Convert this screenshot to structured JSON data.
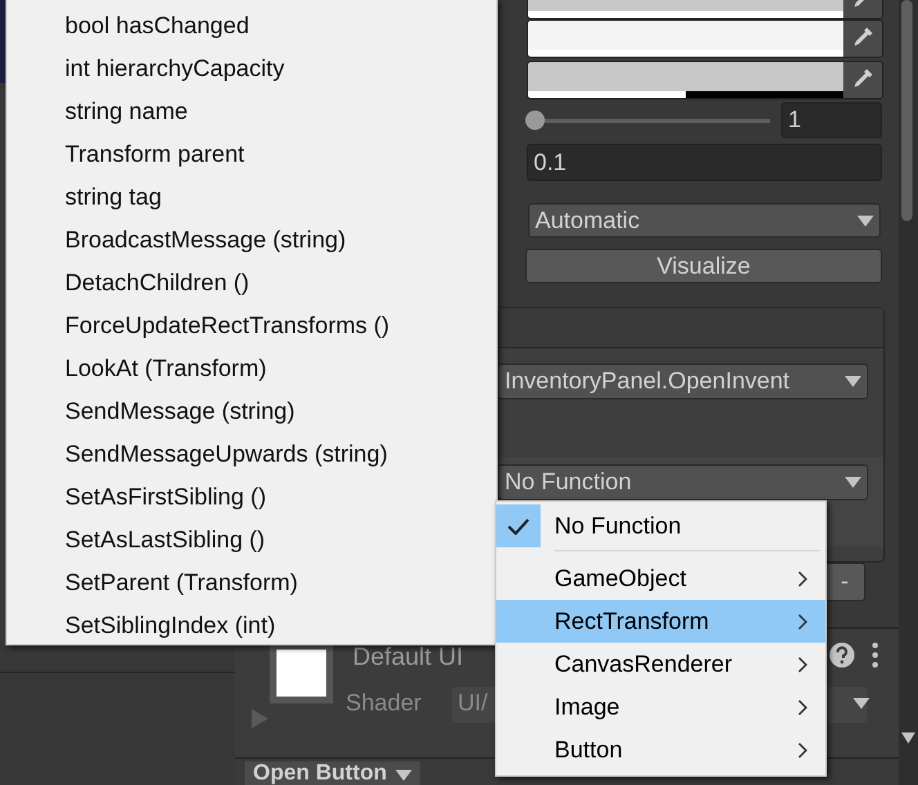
{
  "inspector": {
    "color_fields": [
      {
        "color": "#c8c8c8",
        "level": 1
      },
      {
        "color": "#f4f4f4",
        "level": 1
      },
      {
        "color": "#c8c8c8",
        "level": 0.5
      }
    ],
    "slider": {
      "level": 0,
      "value": "1"
    },
    "number_field": {
      "value": "0.1"
    },
    "mode_dropdown": {
      "value": "Automatic"
    },
    "visualize_button": "Visualize",
    "event_panel": {
      "target_function": "InventoryPanel.OpenInvent",
      "second_function": "No Function",
      "remove_button": "-"
    },
    "material": {
      "name": "Default UI",
      "shader_label": "Shader",
      "shader_value": "UI/"
    },
    "bottom_tab": "Open Button"
  },
  "member_menu": {
    "items": [
      {
        "label": "bool hasChanged"
      },
      {
        "label": "int hierarchyCapacity"
      },
      {
        "label": "string name"
      },
      {
        "label": "Transform parent"
      },
      {
        "label": "string tag"
      },
      {
        "label": "BroadcastMessage (string)"
      },
      {
        "label": "DetachChildren ()"
      },
      {
        "label": "ForceUpdateRectTransforms ()"
      },
      {
        "label": "LookAt (Transform)"
      },
      {
        "label": "SendMessage (string)"
      },
      {
        "label": "SendMessageUpwards (string)"
      },
      {
        "label": "SetAsFirstSibling ()"
      },
      {
        "label": "SetAsLastSibling ()"
      },
      {
        "label": "SetParent (Transform)"
      },
      {
        "label": "SetSiblingIndex (int)"
      }
    ]
  },
  "function_menu": {
    "items": [
      {
        "label": "No Function",
        "checked": true,
        "selected": false,
        "submenu": false,
        "separator_after": true
      },
      {
        "label": "GameObject",
        "checked": false,
        "selected": false,
        "submenu": true,
        "separator_after": false
      },
      {
        "label": "RectTransform",
        "checked": false,
        "selected": true,
        "submenu": true,
        "separator_after": false
      },
      {
        "label": "CanvasRenderer",
        "checked": false,
        "selected": false,
        "submenu": true,
        "separator_after": false
      },
      {
        "label": "Image",
        "checked": false,
        "selected": false,
        "submenu": true,
        "separator_after": false
      },
      {
        "label": "Button",
        "checked": false,
        "selected": false,
        "submenu": true,
        "separator_after": false
      }
    ]
  }
}
